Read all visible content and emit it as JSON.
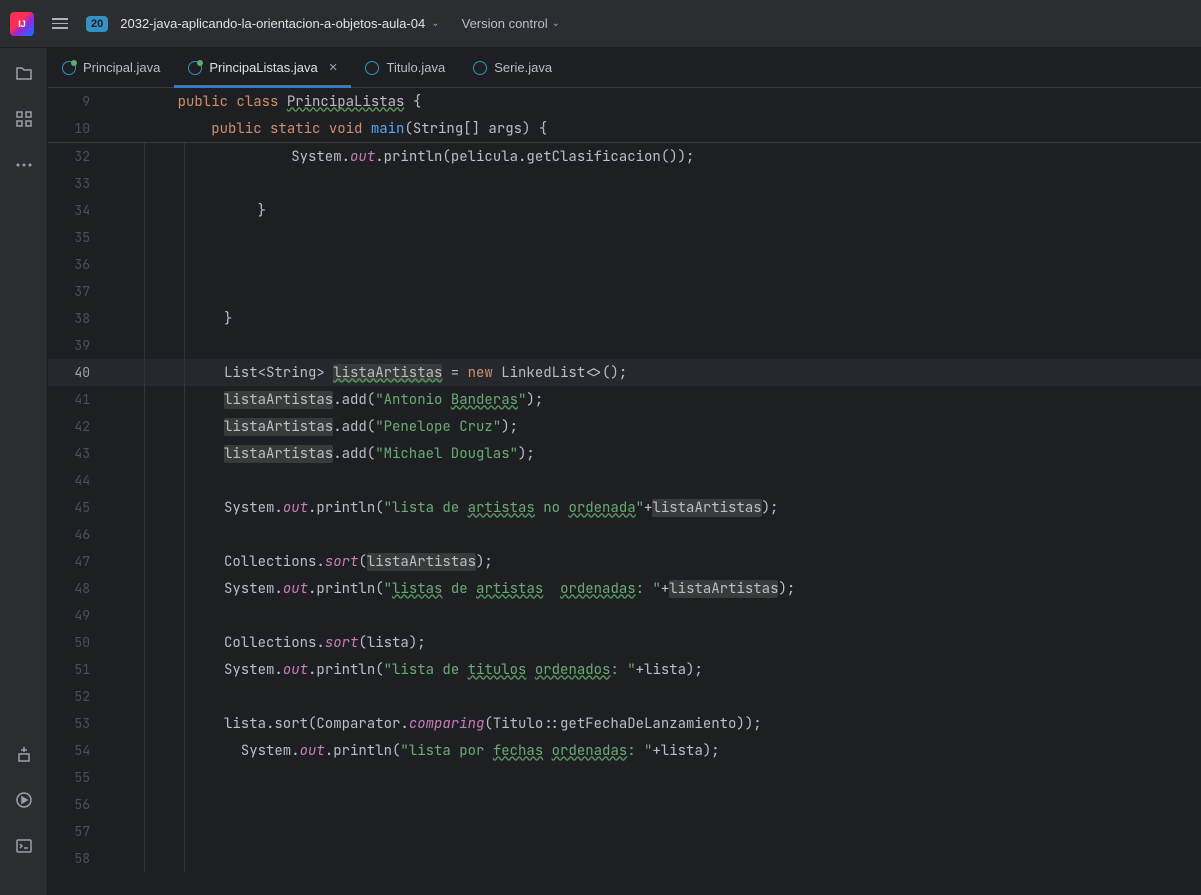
{
  "titlebar": {
    "project_badge": "20",
    "project_name": "2032-java-aplicando-la-orientacion-a-objetos-aula-04",
    "version_control": "Version control"
  },
  "tabs": [
    {
      "label": "Principal.java",
      "active": false,
      "modified": true,
      "closable": false
    },
    {
      "label": "PrincipaListas.java",
      "active": true,
      "modified": true,
      "closable": true
    },
    {
      "label": "Titulo.java",
      "active": false,
      "modified": false,
      "closable": false
    },
    {
      "label": "Serie.java",
      "active": false,
      "modified": false,
      "closable": false
    }
  ],
  "sticky_lines": [
    {
      "num": "9",
      "indent": 1,
      "tokens": [
        {
          "t": "public ",
          "c": "kw"
        },
        {
          "t": "class ",
          "c": "kw"
        },
        {
          "t": "PrincipaListas",
          "c": "cls typo"
        },
        {
          "t": " {",
          "c": ""
        }
      ]
    },
    {
      "num": "10",
      "indent": 2,
      "tokens": [
        {
          "t": "public ",
          "c": "kw"
        },
        {
          "t": "static ",
          "c": "kw"
        },
        {
          "t": "void ",
          "c": "kw"
        },
        {
          "t": "main",
          "c": "fn"
        },
        {
          "t": "(String[] args) {",
          "c": ""
        }
      ]
    }
  ],
  "lines": [
    {
      "num": "32",
      "indent": 4,
      "tokens": [
        {
          "t": "System.",
          "c": ""
        },
        {
          "t": "out",
          "c": "fld"
        },
        {
          "t": ".println(pelicula.getClasificacion());",
          "c": ""
        }
      ]
    },
    {
      "num": "33",
      "indent": 4,
      "tokens": [
        {
          "t": "",
          "c": ""
        }
      ]
    },
    {
      "num": "34",
      "indent": 3,
      "tokens": [
        {
          "t": "}",
          "c": ""
        }
      ]
    },
    {
      "num": "35",
      "indent": 0,
      "tokens": [
        {
          "t": "",
          "c": ""
        }
      ]
    },
    {
      "num": "36",
      "indent": 0,
      "tokens": [
        {
          "t": "",
          "c": ""
        }
      ]
    },
    {
      "num": "37",
      "indent": 0,
      "tokens": [
        {
          "t": "",
          "c": ""
        }
      ]
    },
    {
      "num": "38",
      "indent": 2,
      "tokens": [
        {
          "t": "}",
          "c": ""
        }
      ]
    },
    {
      "num": "39",
      "indent": 0,
      "tokens": [
        {
          "t": "",
          "c": ""
        }
      ]
    },
    {
      "num": "40",
      "hl": true,
      "indent": 2,
      "tokens": [
        {
          "t": "List<String> ",
          "c": ""
        },
        {
          "t": "listaArtistas",
          "c": "hl-usage typo"
        },
        {
          "t": " = ",
          "c": ""
        },
        {
          "t": "new ",
          "c": "kw"
        },
        {
          "t": "LinkedList<>();",
          "c": ""
        }
      ]
    },
    {
      "num": "41",
      "indent": 2,
      "tokens": [
        {
          "t": "listaArtistas",
          "c": "hl-usage"
        },
        {
          "t": ".add(",
          "c": ""
        },
        {
          "t": "\"Antonio ",
          "c": "st"
        },
        {
          "t": "Banderas",
          "c": "st typo"
        },
        {
          "t": "\"",
          "c": "st"
        },
        {
          "t": ");",
          "c": ""
        }
      ]
    },
    {
      "num": "42",
      "indent": 2,
      "tokens": [
        {
          "t": "listaArtistas",
          "c": "hl-usage"
        },
        {
          "t": ".add(",
          "c": ""
        },
        {
          "t": "\"Penelope Cruz\"",
          "c": "st"
        },
        {
          "t": ");",
          "c": ""
        }
      ]
    },
    {
      "num": "43",
      "indent": 2,
      "tokens": [
        {
          "t": "listaArtistas",
          "c": "hl-usage"
        },
        {
          "t": ".add(",
          "c": ""
        },
        {
          "t": "\"Michael Douglas\"",
          "c": "st"
        },
        {
          "t": ");",
          "c": ""
        }
      ]
    },
    {
      "num": "44",
      "indent": 0,
      "tokens": [
        {
          "t": "",
          "c": ""
        }
      ]
    },
    {
      "num": "45",
      "indent": 2,
      "tokens": [
        {
          "t": "System.",
          "c": ""
        },
        {
          "t": "out",
          "c": "fld"
        },
        {
          "t": ".println(",
          "c": ""
        },
        {
          "t": "\"lista de ",
          "c": "st"
        },
        {
          "t": "artistas",
          "c": "st typo"
        },
        {
          "t": " no ",
          "c": "st"
        },
        {
          "t": "ordenada",
          "c": "st typo"
        },
        {
          "t": "\"",
          "c": "st"
        },
        {
          "t": "+",
          "c": ""
        },
        {
          "t": "listaArtistas",
          "c": "hl-usage"
        },
        {
          "t": ");",
          "c": ""
        }
      ]
    },
    {
      "num": "46",
      "indent": 0,
      "tokens": [
        {
          "t": "",
          "c": ""
        }
      ]
    },
    {
      "num": "47",
      "indent": 2,
      "tokens": [
        {
          "t": "Collections.",
          "c": ""
        },
        {
          "t": "sort",
          "c": "fld"
        },
        {
          "t": "(",
          "c": ""
        },
        {
          "t": "listaArtistas",
          "c": "hl-usage"
        },
        {
          "t": ");",
          "c": ""
        }
      ]
    },
    {
      "num": "48",
      "indent": 2,
      "tokens": [
        {
          "t": "System.",
          "c": ""
        },
        {
          "t": "out",
          "c": "fld"
        },
        {
          "t": ".println(",
          "c": ""
        },
        {
          "t": "\"",
          "c": "st"
        },
        {
          "t": "listas",
          "c": "st typo"
        },
        {
          "t": " de ",
          "c": "st"
        },
        {
          "t": "artistas",
          "c": "st typo"
        },
        {
          "t": "  ",
          "c": "st"
        },
        {
          "t": "ordenadas",
          "c": "st typo"
        },
        {
          "t": ": \"",
          "c": "st"
        },
        {
          "t": "+",
          "c": ""
        },
        {
          "t": "listaArtistas",
          "c": "hl-usage"
        },
        {
          "t": ");",
          "c": ""
        }
      ]
    },
    {
      "num": "49",
      "indent": 0,
      "tokens": [
        {
          "t": "",
          "c": ""
        }
      ]
    },
    {
      "num": "50",
      "indent": 2,
      "tokens": [
        {
          "t": "Collections.",
          "c": ""
        },
        {
          "t": "sort",
          "c": "fld"
        },
        {
          "t": "(lista);",
          "c": ""
        }
      ]
    },
    {
      "num": "51",
      "indent": 2,
      "tokens": [
        {
          "t": "System.",
          "c": ""
        },
        {
          "t": "out",
          "c": "fld"
        },
        {
          "t": ".println(",
          "c": ""
        },
        {
          "t": "\"lista de ",
          "c": "st"
        },
        {
          "t": "titulos",
          "c": "st typo"
        },
        {
          "t": " ",
          "c": "st"
        },
        {
          "t": "ordenados",
          "c": "st typo"
        },
        {
          "t": ": \"",
          "c": "st"
        },
        {
          "t": "+lista);",
          "c": ""
        }
      ]
    },
    {
      "num": "52",
      "indent": 0,
      "tokens": [
        {
          "t": "",
          "c": ""
        }
      ]
    },
    {
      "num": "53",
      "indent": 2,
      "tokens": [
        {
          "t": "lista.sort(Comparator.",
          "c": ""
        },
        {
          "t": "comparing",
          "c": "fld"
        },
        {
          "t": "(Titulo::getFechaDeLanzamiento));",
          "c": ""
        }
      ]
    },
    {
      "num": "54",
      "indent": 2,
      "ext": 1,
      "tokens": [
        {
          "t": "  System.",
          "c": ""
        },
        {
          "t": "out",
          "c": "fld"
        },
        {
          "t": ".println(",
          "c": ""
        },
        {
          "t": "\"lista por ",
          "c": "st"
        },
        {
          "t": "fechas",
          "c": "st typo"
        },
        {
          "t": " ",
          "c": "st"
        },
        {
          "t": "ordenadas",
          "c": "st typo"
        },
        {
          "t": ": \"",
          "c": "st"
        },
        {
          "t": "+lista);",
          "c": ""
        }
      ]
    },
    {
      "num": "55",
      "indent": 0,
      "tokens": [
        {
          "t": "",
          "c": ""
        }
      ]
    },
    {
      "num": "56",
      "indent": 0,
      "tokens": [
        {
          "t": "",
          "c": ""
        }
      ]
    },
    {
      "num": "57",
      "indent": 0,
      "tokens": [
        {
          "t": "",
          "c": ""
        }
      ]
    },
    {
      "num": "58",
      "indent": 0,
      "tokens": [
        {
          "t": "",
          "c": ""
        }
      ]
    }
  ]
}
